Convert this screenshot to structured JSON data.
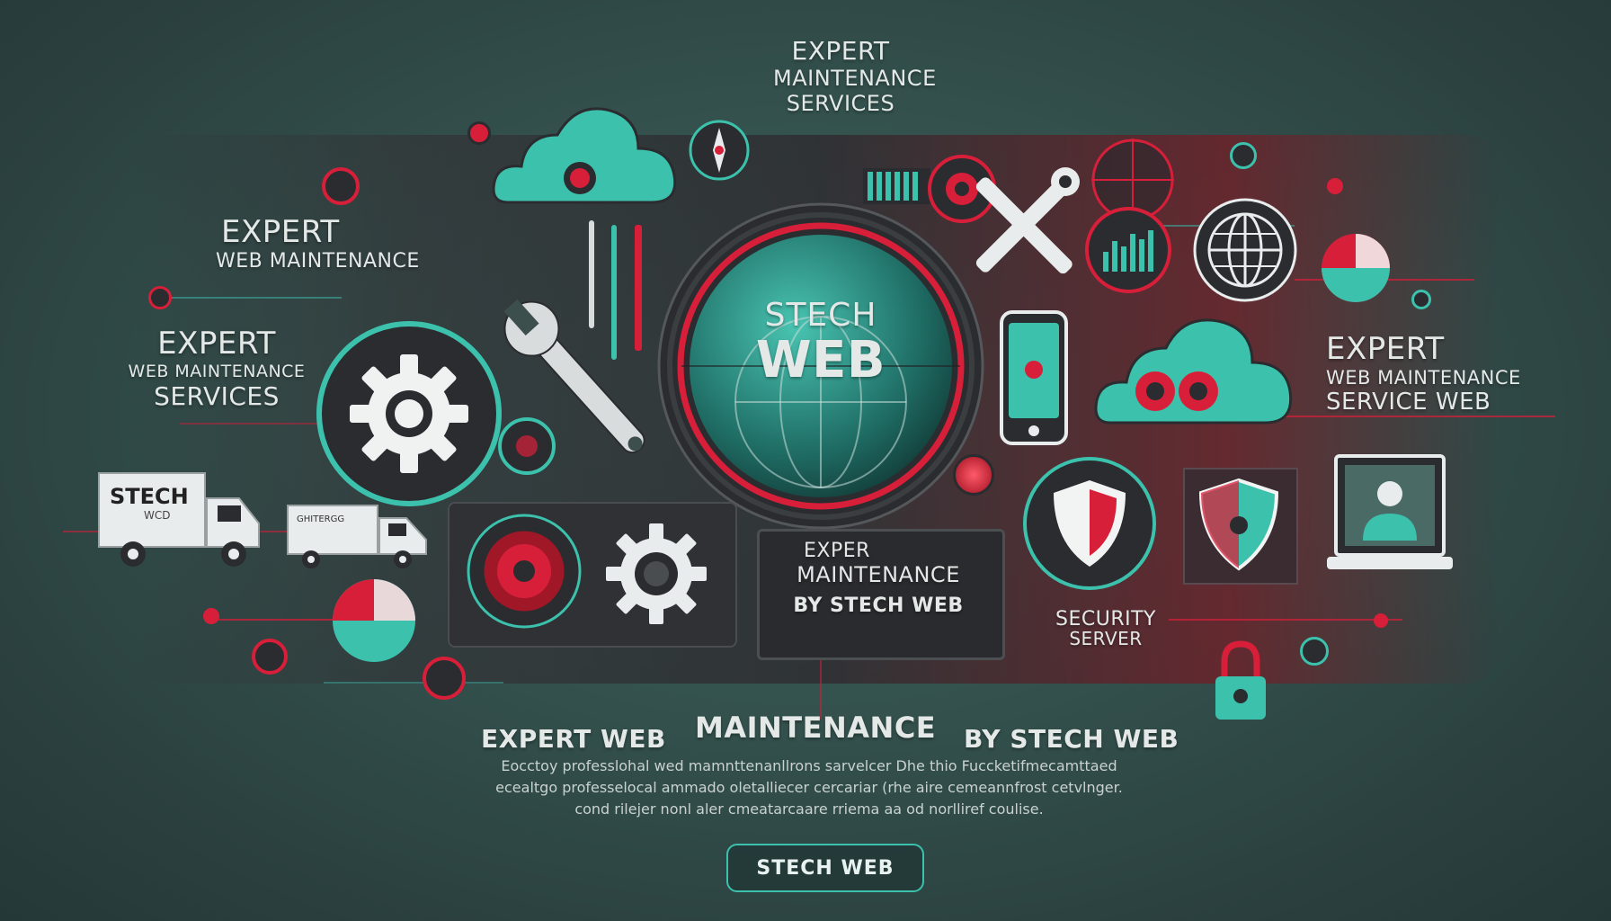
{
  "headings": {
    "top_center": [
      "EXPERT",
      "MAINTENANCE",
      "SERVICES"
    ],
    "left_1": [
      "EXPERT",
      "WEB MAINTENANCE"
    ],
    "left_2": [
      "EXPERT",
      "WEB MAINTENANCE",
      "SERVICES"
    ],
    "right": [
      "EXPERT",
      "WEB MAINTENANCE",
      "SERVICE WEB"
    ],
    "center_badge": [
      "STECH",
      "WEB"
    ],
    "panel_mid": [
      "EXPER",
      "MAINTENANCE",
      "BY STECH WEB"
    ],
    "security": [
      "SECURITY",
      "SERVER"
    ]
  },
  "trucks": {
    "truck1_label": "STECH",
    "truck1_sub": "WCD",
    "truck2_label": "GHITERGG"
  },
  "bottom": {
    "title_left": "EXPERT WEB",
    "title_mid": "MAINTENANCE",
    "title_right": "BY STECH WEB",
    "tagline_lines": [
      "Eocctoy professlohal wed mamnttenanllrons sarvelcer Dhe thio Fuccketifmecamttaed",
      "ecealtgo professelocal ammado oletalliecer cercariar (rhe aire cemeannfrost cetvlnger.",
      "cond rilejer nonl aler cmeatarcaare rriema aa od norlliref coulise."
    ],
    "cta_label": "STECH WEB"
  },
  "colors": {
    "teal": "#3cc1ad",
    "red": "#d81f3a",
    "dark": "#2b2c2f",
    "bg": "#33504c"
  }
}
